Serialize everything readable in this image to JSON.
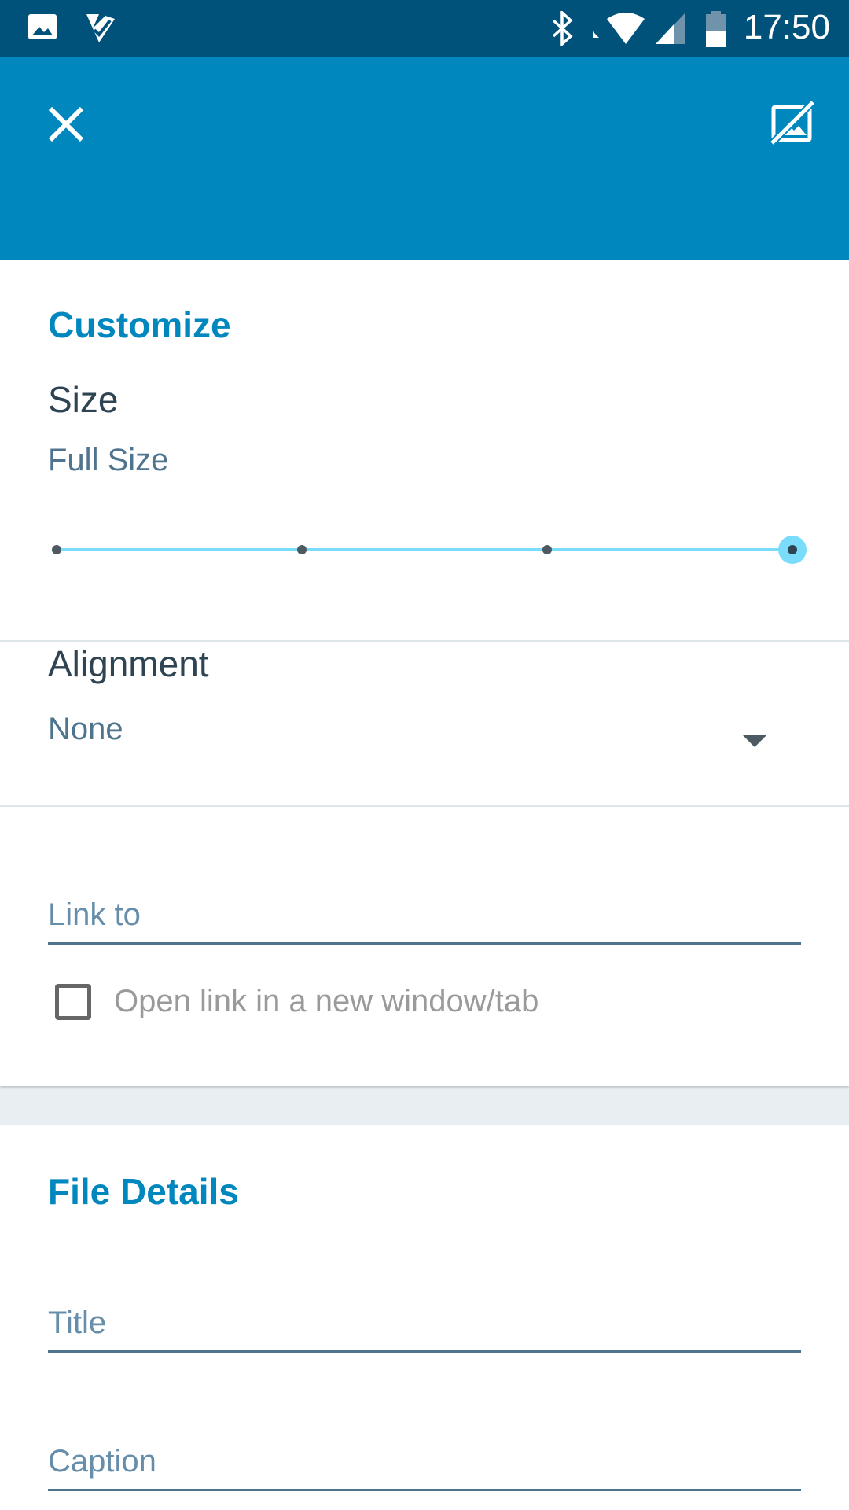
{
  "status_bar": {
    "time": "17:50",
    "icons": [
      "gallery-notification-icon",
      "task-notification-icon",
      "bluetooth-icon",
      "wifi-icon",
      "cell-signal-icon",
      "battery-icon"
    ]
  },
  "app_bar": {
    "close_icon": "close-icon",
    "action_icon": "image-off-icon",
    "color": "#0087be"
  },
  "customize": {
    "section_title": "Customize",
    "size_label": "Size",
    "size_value": "Full Size",
    "size_slider": {
      "steps": 4,
      "selected_index": 3
    },
    "alignment_label": "Alignment",
    "alignment_value": "None",
    "link_to_placeholder": "Link to",
    "open_new_window_label": "Open link in a new window/tab",
    "open_new_window_checked": false
  },
  "file_details": {
    "section_title": "File Details",
    "title_placeholder": "Title",
    "caption_placeholder": "Caption"
  },
  "colors": {
    "accent": "#0087be",
    "status_bar": "#01527a",
    "slider": "#78dcfa"
  }
}
